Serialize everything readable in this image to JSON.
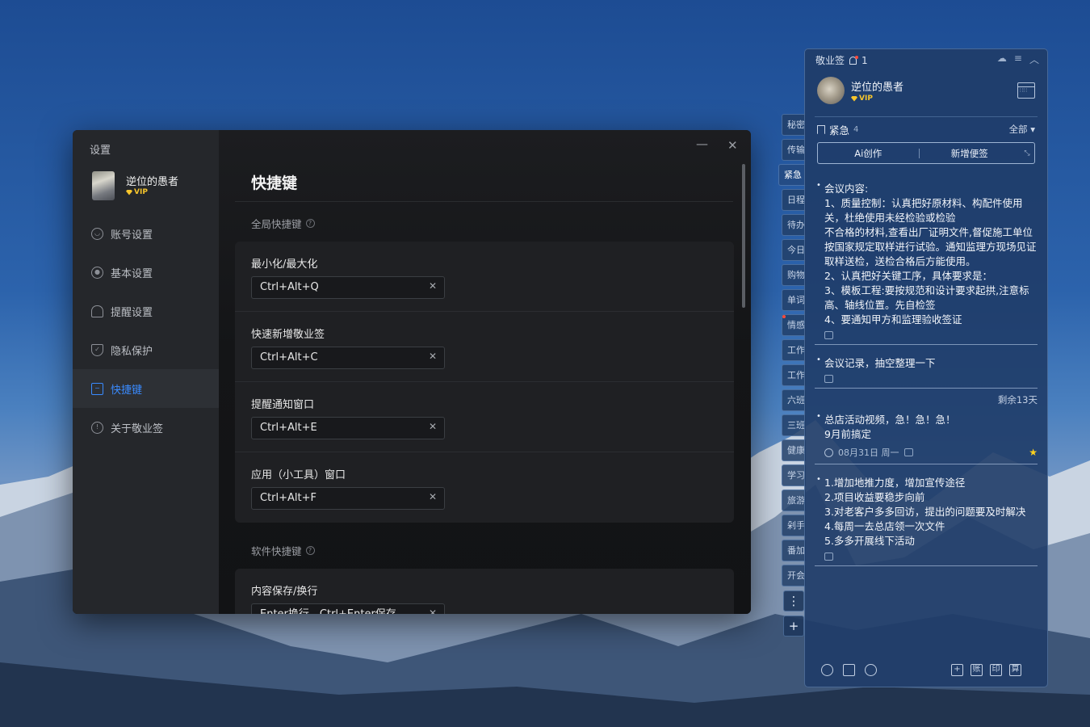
{
  "settings": {
    "title": "设置",
    "user": {
      "name": "逆位的愚者",
      "vip": "VIP"
    },
    "nav": [
      {
        "label": "账号设置",
        "icon": "user-icon"
      },
      {
        "label": "基本设置",
        "icon": "settings-icon"
      },
      {
        "label": "提醒设置",
        "icon": "bell-icon"
      },
      {
        "label": "隐私保护",
        "icon": "shield-icon"
      },
      {
        "label": "快捷键",
        "icon": "keyboard-icon",
        "active": true
      },
      {
        "label": "关于敬业签",
        "icon": "info-icon"
      }
    ],
    "window": {
      "min": "—",
      "close": "✕"
    },
    "page_title": "快捷键",
    "global": {
      "label": "全局快捷键",
      "items": [
        {
          "label": "最小化/最大化",
          "value": "Ctrl+Alt+Q"
        },
        {
          "label": "快速新增敬业签",
          "value": "Ctrl+Alt+C"
        },
        {
          "label": "提醒通知窗口",
          "value": "Ctrl+Alt+E"
        },
        {
          "label": "应用（小工具）窗口",
          "value": "Ctrl+Alt+F"
        }
      ]
    },
    "software": {
      "label": "软件快捷键",
      "items": [
        {
          "label": "内容保存/换行",
          "value": "Enter换行，Ctrl+Enter保存"
        }
      ]
    }
  },
  "tabs": [
    {
      "label": "秘密"
    },
    {
      "label": "传输"
    },
    {
      "label": "紧急",
      "active": true
    },
    {
      "label": "日程"
    },
    {
      "label": "待办"
    },
    {
      "label": "今日"
    },
    {
      "label": "购物"
    },
    {
      "label": "单词"
    },
    {
      "label": "情感",
      "flag": true
    },
    {
      "label": "工作"
    },
    {
      "label": "工作"
    },
    {
      "label": "六班"
    },
    {
      "label": "三班"
    },
    {
      "label": "健康"
    },
    {
      "label": "学习"
    },
    {
      "label": "旅游"
    },
    {
      "label": "剁手"
    },
    {
      "label": "番加"
    },
    {
      "label": "开会"
    }
  ],
  "panel": {
    "app_name": "敬业签",
    "notice_count": "1",
    "user": {
      "name": "逆位的愚者",
      "vip": "VIP"
    },
    "category": {
      "name": "紧急",
      "count": "4"
    },
    "filter": "全部 ▾",
    "tool_ai": "Ai创作",
    "tool_new": "新增便签",
    "notes": [
      {
        "text": "会议内容:\n1、质量控制：认真把好原材料、构配件使用关，杜绝使用未经检验或检验\n不合格的材料,查看出厂证明文件,督促施工单位按国家规定取样进行试验。通知监理方现场见证取样送检，送检合格后方能使用。\n2、认真把好关键工序，具体要求是：\n3、模板工程:要按规范和设计要求起拱,注意标高、轴线位置。先自检签\n4、要通知甲方和监理验收签证"
      },
      {
        "text": "会议记录，抽空整理一下"
      },
      {
        "remain": "剩余13天",
        "text": "总店活动视频，急！急！急！\n9月前搞定",
        "date": "08月31日 周一"
      },
      {
        "text": "1.增加地推力度，增加宣传途径\n2.项目收益要稳步向前\n3.对老客户多多回访，提出的问题要及时解决\n4.每周一去总店领一次文件\n5.多多开展线下活动"
      }
    ],
    "bottom_icons": [
      "clock-icon",
      "archive-icon",
      "search-icon",
      "add-icon",
      "ledger-icon",
      "print-icon",
      "calc-icon"
    ],
    "bottom_labels": {
      "add": "+",
      "ledger": "账",
      "print": "印",
      "calc": "算"
    }
  }
}
